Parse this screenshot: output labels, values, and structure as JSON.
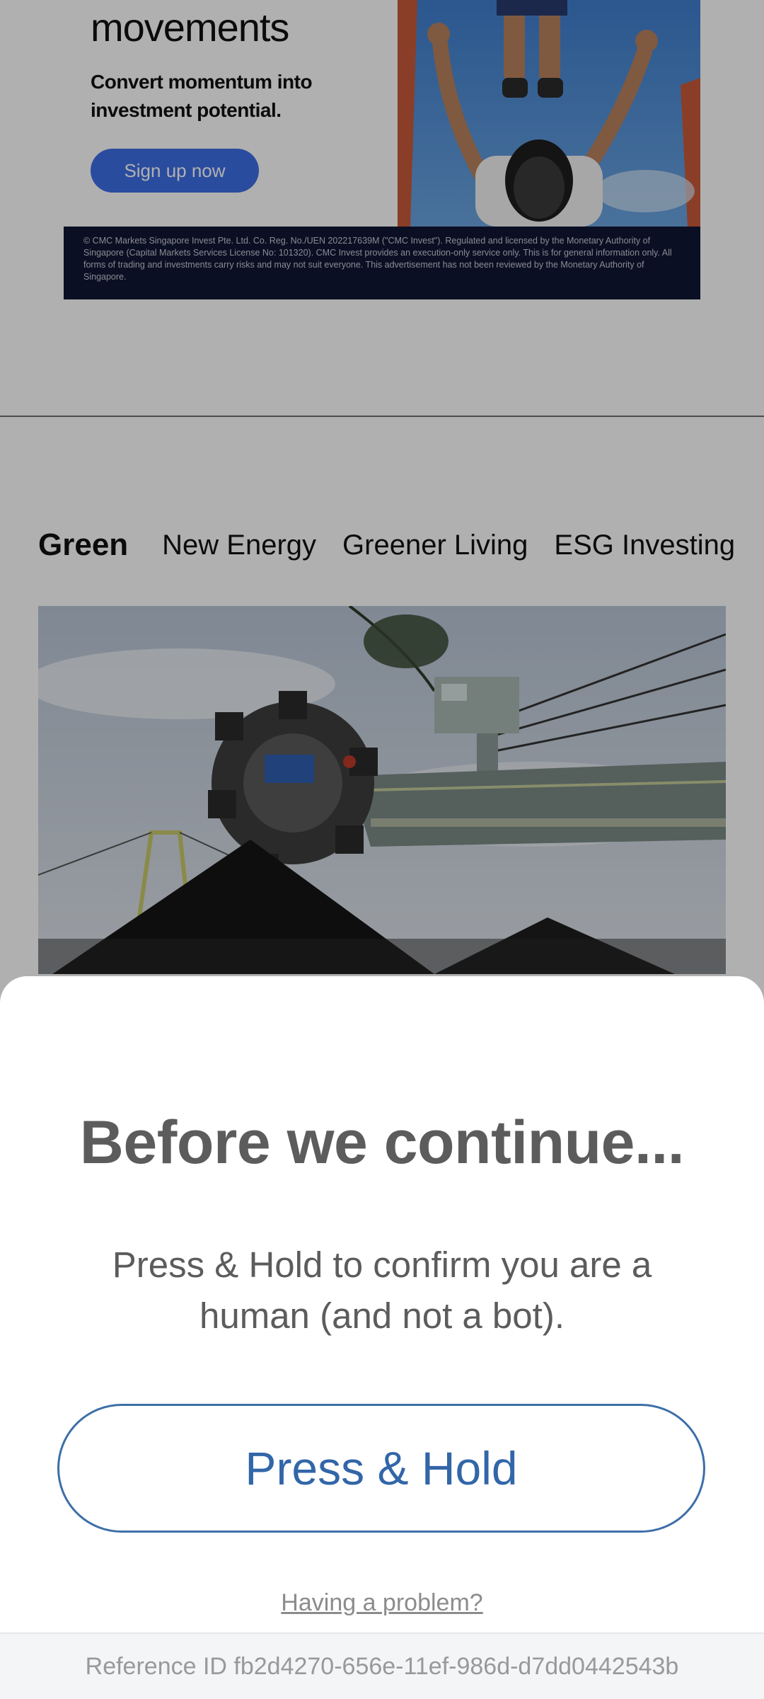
{
  "ad": {
    "headline": "movements",
    "subheadline": "Convert momentum into investment potential.",
    "cta_label": "Sign up now",
    "disclaimer": "© CMC Markets Singapore Invest Pte. Ltd. Co. Reg. No./UEN 202217639M (\"CMC Invest\"). Regulated and licensed by the Monetary Authority of Singapore (Capital Markets Services License No: 101320). CMC Invest provides an execution-only service only. This is for general information only. All forms of trading and investments carry risks and may not suit everyone. This advertisement has not been reviewed by the Monetary Authority of Singapore."
  },
  "section_nav": {
    "items": [
      {
        "label": "Green"
      },
      {
        "label": "New Energy"
      },
      {
        "label": "Greener Living"
      },
      {
        "label": "ESG Investing"
      }
    ]
  },
  "hero": {
    "image": "coal-bucket-wheel-reclaimer-photo"
  },
  "sheet": {
    "title": "Before we continue...",
    "instruction": "Press & Hold to confirm you are a human (and not a bot).",
    "button_label": "Press & Hold",
    "problem_link": "Having a problem?",
    "reference": "Reference ID fb2d4270-656e-11ef-986d-d7dd0442543b"
  },
  "colors": {
    "accent": "#3266a8",
    "ad_button": "#3d6fe6",
    "ad_disclaimer_bg": "#101733",
    "sheet_text": "#5c5c5c"
  }
}
